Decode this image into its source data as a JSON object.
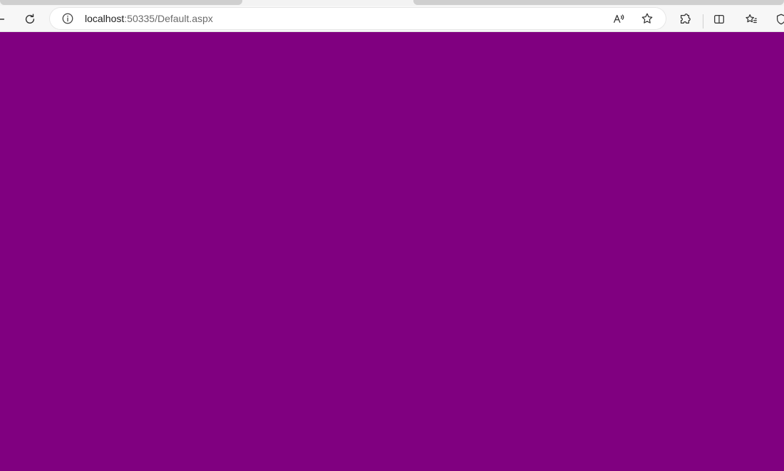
{
  "browser": {
    "url_host": "localhost",
    "url_rest": ":50335/Default.aspx",
    "toolbar_icons": [
      "back-arrow-icon",
      "reload-icon",
      "site-info-icon",
      "read-aloud-icon",
      "favorite-star-icon",
      "extensions-icon",
      "split-screen-icon",
      "favorites-icon",
      "browser-essentials-icon"
    ]
  },
  "page": {
    "background": "#800080",
    "message": "",
    "message_color": "#ff0000"
  }
}
